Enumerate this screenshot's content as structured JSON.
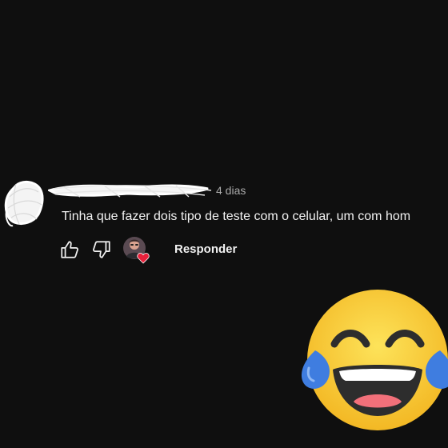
{
  "comment": {
    "timestamp": "4 dias",
    "text": "Tinha que fazer dois tipo de teste com o celular, um com hom",
    "reply_label": "Responder"
  },
  "icons": {
    "like": "thumb-up-icon",
    "dislike": "thumb-down-icon",
    "creator_heart": "creator-heart-icon",
    "emoji": "face-with-tears-of-joy-emoji"
  },
  "colors": {
    "background": "#0f0f0f",
    "text": "#f1f1f1",
    "secondary_text": "#aaaaaa",
    "heart": "#e8213b",
    "emoji_face": "#f7c330",
    "emoji_tears": "#3f7de0"
  }
}
